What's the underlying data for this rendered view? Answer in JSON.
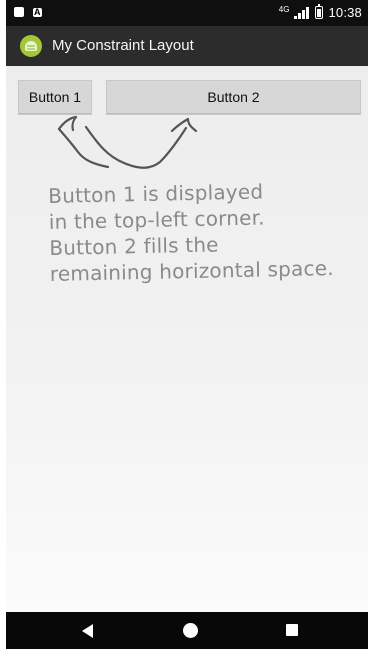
{
  "status_bar": {
    "network": "4G",
    "time": "10:38"
  },
  "app_bar": {
    "title": "My Constraint Layout",
    "logo_icon": "android-logo-icon"
  },
  "buttons": {
    "button1_label": "Button 1",
    "button2_label": "Button 2"
  },
  "annotation": {
    "lines": [
      "Button 1 is displayed",
      "in the top-left corner.",
      "Button 2 fills the",
      "remaining horizontal space."
    ]
  },
  "navigation": {
    "back_icon": "back-icon",
    "home_icon": "home-icon",
    "recents_icon": "recents-icon"
  }
}
